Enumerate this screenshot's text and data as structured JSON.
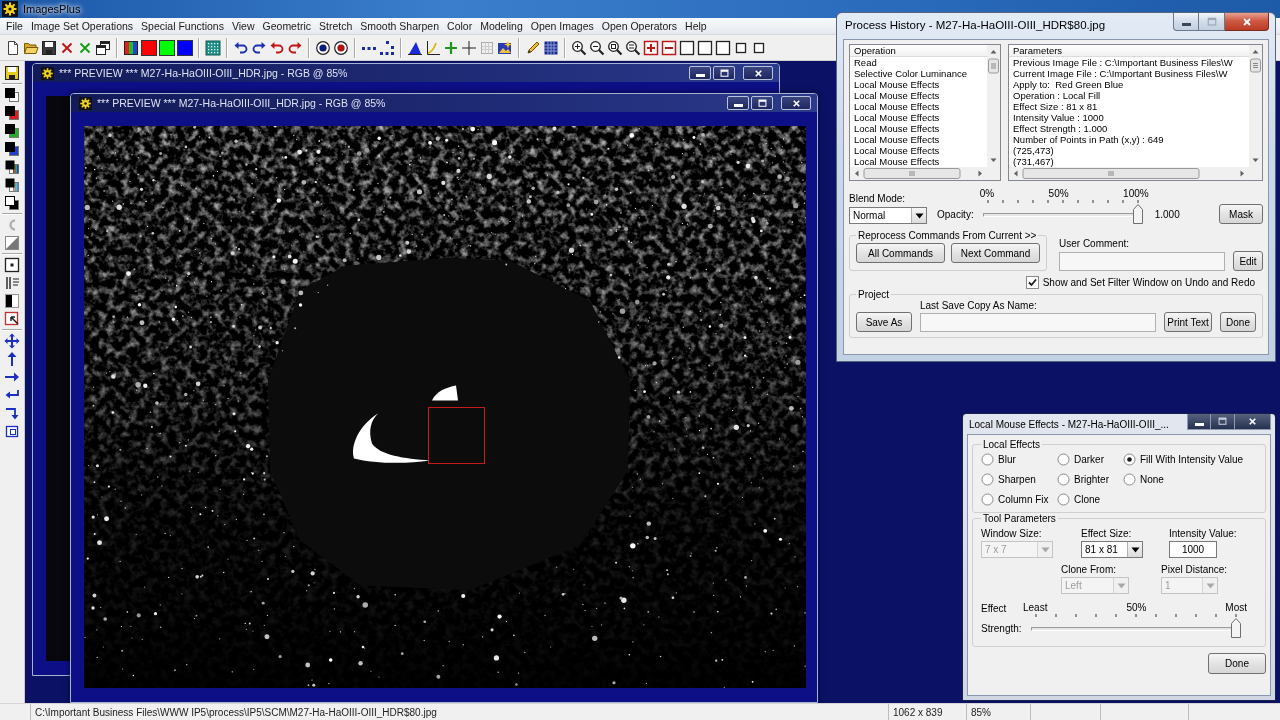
{
  "app": {
    "title": "ImagesPlus"
  },
  "menu": [
    "File",
    "Image Set Operations",
    "Special Functions",
    "View",
    "Geometric",
    "Stretch",
    "Smooth Sharpen",
    "Color",
    "Modeling",
    "Open Images",
    "Open Operators",
    "Help"
  ],
  "preview_windows": [
    {
      "title": "*** PREVIEW *** M27-Ha-HaOIII-OIII_HDR.jpg - RGB @ 85%"
    },
    {
      "title": "*** PREVIEW *** M27-Ha-HaOIII-OIII_HDR.jpg - RGB @ 85%"
    }
  ],
  "process_history": {
    "title": "Process History - M27-Ha-HaOIII-OIII_HDR$80.jpg",
    "operations": {
      "header": "Operation",
      "items": [
        "Read",
        "Selective Color Luminance",
        "Local Mouse Effects",
        "Local Mouse Effects",
        "Local Mouse Effects",
        "Local Mouse Effects",
        "Local Mouse Effects",
        "Local Mouse Effects",
        "Local Mouse Effects",
        "Local Mouse Effects"
      ]
    },
    "parameters": {
      "header": "Parameters",
      "items": [
        "Previous Image File : C:\\Important Business Files\\W",
        "Current Image File : C:\\Important Business Files\\W",
        "Apply to:  Red Green Blue",
        "Operation : Local Fill",
        "Effect Size : 81 x 81",
        "Intensity Value : 1000",
        "Effect Strength : 1.000",
        "Number of Points in Path (x,y) : 649",
        "(725,473)",
        "(731,467)"
      ]
    },
    "blend_mode": {
      "label": "Blend Mode:",
      "value": "Normal"
    },
    "opacity": {
      "label": "Opacity:",
      "ticks": [
        "0%",
        "50%",
        "100%"
      ],
      "level": 1,
      "reading": "1.000"
    },
    "mask_button": "Mask",
    "reprocess": {
      "title": "Reprocess Commands From Current >>",
      "buttons": [
        "All Commands",
        "Next Command"
      ]
    },
    "user_comment": {
      "label": "User Comment:",
      "button": "Edit"
    },
    "filter_window": {
      "label": "Show and Set Filter Window on Undo and Redo",
      "checked": true
    },
    "project": {
      "title": "Project",
      "save_as": "Save As",
      "last_save_label": "Last Save Copy As Name:",
      "print_text": "Print Text",
      "done": "Done"
    }
  },
  "local_mouse_effects": {
    "title": "Local Mouse Effects - M27-Ha-HaOIII-OIII_...",
    "effects": {
      "title": "Local Effects",
      "options": [
        {
          "label": "Blur",
          "selected": false
        },
        {
          "label": "Darker",
          "selected": false
        },
        {
          "label": "Fill With Intensity Value",
          "selected": true
        },
        {
          "label": "Sharpen",
          "selected": false
        },
        {
          "label": "Brighter",
          "selected": false
        },
        {
          "label": "None",
          "selected": false
        },
        {
          "label": "Column Fix",
          "selected": false
        },
        {
          "label": "Clone",
          "selected": false
        }
      ]
    },
    "tool_parameters": {
      "title": "Tool Parameters",
      "rows": [
        {
          "fields": [
            {
              "label": "Window Size:",
              "kind": "dropdown",
              "value": "7 x 7",
              "disabled": true
            },
            {
              "label": "Effect Size:",
              "kind": "dropdown",
              "value": "81 x 81",
              "disabled": false
            },
            {
              "label": "Intensity Value:",
              "kind": "input",
              "value": "1000",
              "disabled": false
            }
          ]
        },
        {
          "fields": [
            {
              "label": "Clone From:",
              "kind": "dropdown",
              "value": "Left",
              "disabled": true
            },
            {
              "label": "Pixel Distance:",
              "kind": "dropdown",
              "value": "1",
              "disabled": true
            }
          ]
        }
      ]
    },
    "strength": {
      "label_top": "Effect",
      "label_bottom": "Strength:",
      "scale": [
        "Least",
        "50%",
        "Most"
      ],
      "level": 1
    },
    "done": "Done"
  },
  "status_bar": {
    "path": "C:\\Important Business Files\\WWW IP5\\process\\IP5\\SCM\\M27-Ha-HaOIII-OIII_HDR$80.jpg",
    "size": "1062 x 839",
    "zoom": "85%"
  }
}
